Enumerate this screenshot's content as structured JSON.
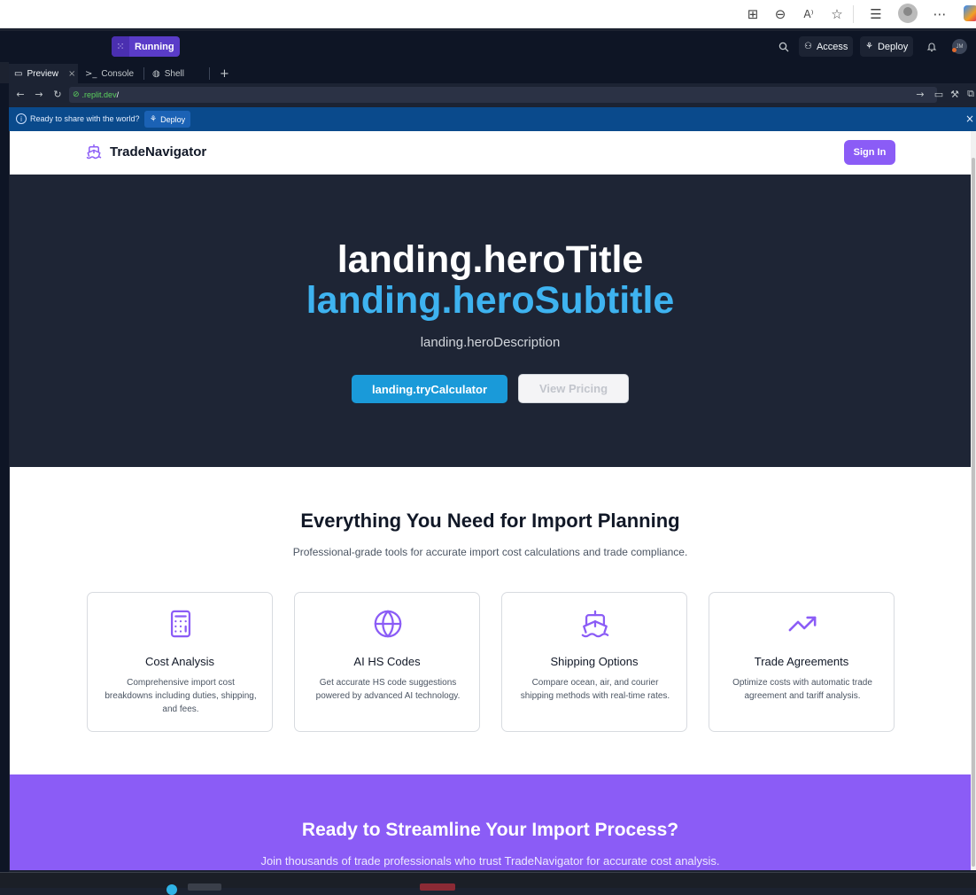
{
  "replit": {
    "status": "Running",
    "access_label": "Access",
    "deploy_label": "Deploy",
    "avatar_initials": "JM",
    "tabs": [
      {
        "label": "Preview"
      },
      {
        "label": "Console"
      },
      {
        "label": "Shell"
      }
    ],
    "url": ".replit.dev",
    "url_suffix": "/",
    "share_text": "Ready to share with the world?",
    "share_deploy": "Deploy"
  },
  "site": {
    "brand": "TradeNavigator",
    "signin": "Sign In",
    "hero": {
      "title": "landing.heroTitle",
      "subtitle": "landing.heroSubtitle",
      "description": "landing.heroDescription",
      "primary_button": "landing.tryCalculator",
      "secondary_button": "View Pricing"
    },
    "features": {
      "title": "Everything You Need for Import Planning",
      "subtitle": "Professional-grade tools for accurate import cost calculations and trade compliance.",
      "cards": [
        {
          "icon": "calculator-icon",
          "title": "Cost Analysis",
          "description": "Comprehensive import cost breakdowns including duties, shipping, and fees."
        },
        {
          "icon": "globe-icon",
          "title": "AI HS Codes",
          "description": "Get accurate HS code suggestions powered by advanced AI technology."
        },
        {
          "icon": "ship-icon",
          "title": "Shipping Options",
          "description": "Compare ocean, air, and courier shipping methods with real-time rates."
        },
        {
          "icon": "trending-up-icon",
          "title": "Trade Agreements",
          "description": "Optimize costs with automatic trade agreement and tariff analysis."
        }
      ]
    },
    "cta": {
      "title": "Ready to Streamline Your Import Process?",
      "subtitle": "Join thousands of trade professionals who trust TradeNavigator for accurate cost analysis."
    }
  },
  "colors": {
    "accent_purple": "#8b5cf6",
    "hero_bg": "#1e2535",
    "hero_subtitle": "#3eb3f0",
    "primary_button": "#1a9ad9"
  }
}
